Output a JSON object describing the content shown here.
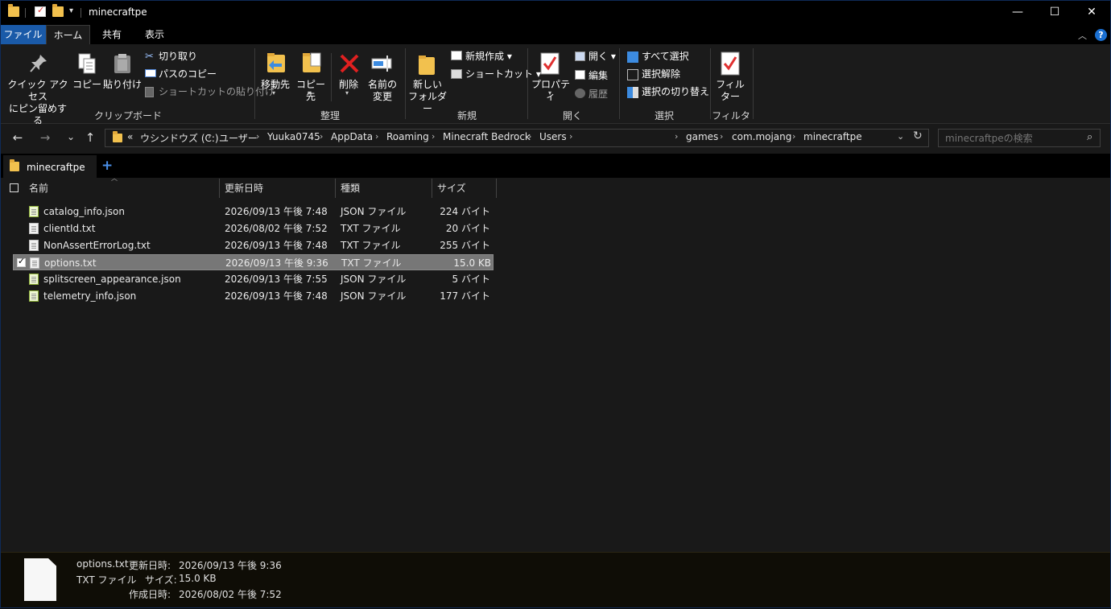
{
  "window": {
    "title": "minecraftpe",
    "buttons": {
      "minimize": "—",
      "maximize": "☐",
      "close": "✕"
    }
  },
  "menu_tabs": [
    "ファイル",
    "ホーム",
    "共有",
    "表示"
  ],
  "ribbon": {
    "clipboard": {
      "pin": "クイック アクセス\nにピン留めする",
      "copy": "コピー",
      "paste": "貼り付け",
      "cut": "切り取り",
      "copy_path": "パスのコピー",
      "paste_shortcut": "ショートカットの貼り付け",
      "label": "クリップボード"
    },
    "organize": {
      "move_to": "移動先",
      "copy_to": "コピー先",
      "delete": "削除",
      "rename": "名前の\n変更",
      "label": "整理"
    },
    "new": {
      "new_folder": "新しい\nフォルダー",
      "new_item": "新規作成",
      "shortcut": "ショートカット",
      "label": "新規"
    },
    "open": {
      "properties": "プロパティ",
      "open": "開く",
      "edit": "編集",
      "history": "履歴",
      "label": "開く"
    },
    "select": {
      "select_all": "すべて選択",
      "select_none": "選択解除",
      "invert": "選択の切り替え",
      "label": "選択"
    },
    "filter": {
      "filter": "フィル\nター",
      "label": "フィルター"
    }
  },
  "nav": {
    "back": "←",
    "forward": "→",
    "recent": "⌄",
    "up": "↑",
    "overflow": "«",
    "breadcrumbs": [
      "ウシンドウズ (C:)",
      "ユーザー",
      "Yuuka0745",
      "AppData",
      "Roaming",
      "Minecraft Bedrock",
      "Users",
      "games",
      "com.mojang",
      "minecraftpe"
    ],
    "search_placeholder": "minecraftpeの検索"
  },
  "tabs": {
    "current": "minecraftpe",
    "add": "+"
  },
  "columns": {
    "name": "名前",
    "modified": "更新日時",
    "type": "種類",
    "size": "サイズ"
  },
  "files": [
    {
      "name": "catalog_info.json",
      "modified": "2026/09/13 午後 7:48",
      "type": "JSON ファイル",
      "size": "224 バイト",
      "kind": "json",
      "selected": false
    },
    {
      "name": "clientId.txt",
      "modified": "2026/08/02 午後 7:52",
      "type": "TXT ファイル",
      "size": "20 バイト",
      "kind": "txt",
      "selected": false
    },
    {
      "name": "NonAssertErrorLog.txt",
      "modified": "2026/09/13 午後 7:48",
      "type": "TXT ファイル",
      "size": "255 バイト",
      "kind": "txt",
      "selected": false
    },
    {
      "name": "options.txt",
      "modified": "2026/09/13 午後 9:36",
      "type": "TXT ファイル",
      "size": "15.0 KB",
      "kind": "txt",
      "selected": true
    },
    {
      "name": "splitscreen_appearance.json",
      "modified": "2026/09/13 午後 7:55",
      "type": "JSON ファイル",
      "size": "5 バイト",
      "kind": "json",
      "selected": false
    },
    {
      "name": "telemetry_info.json",
      "modified": "2026/09/13 午後 7:48",
      "type": "JSON ファイル",
      "size": "177 バイト",
      "kind": "json",
      "selected": false
    }
  ],
  "details": {
    "name": "options.txt",
    "type": "TXT ファイル",
    "modified_label": "更新日時:",
    "modified": "2026/09/13 午後 9:36",
    "size_label": "サイズ:",
    "size": "15.0 KB",
    "created_label": "作成日時:",
    "created": "2026/08/02 午後 7:52"
  },
  "colors": {
    "title_bg": "#000000",
    "accent_tab": "#1a5aa8",
    "ribbon_bg": "#1b1b1b",
    "list_bg": "#191919",
    "selected_row": "#777777",
    "details_bg": "#0f0d06"
  }
}
